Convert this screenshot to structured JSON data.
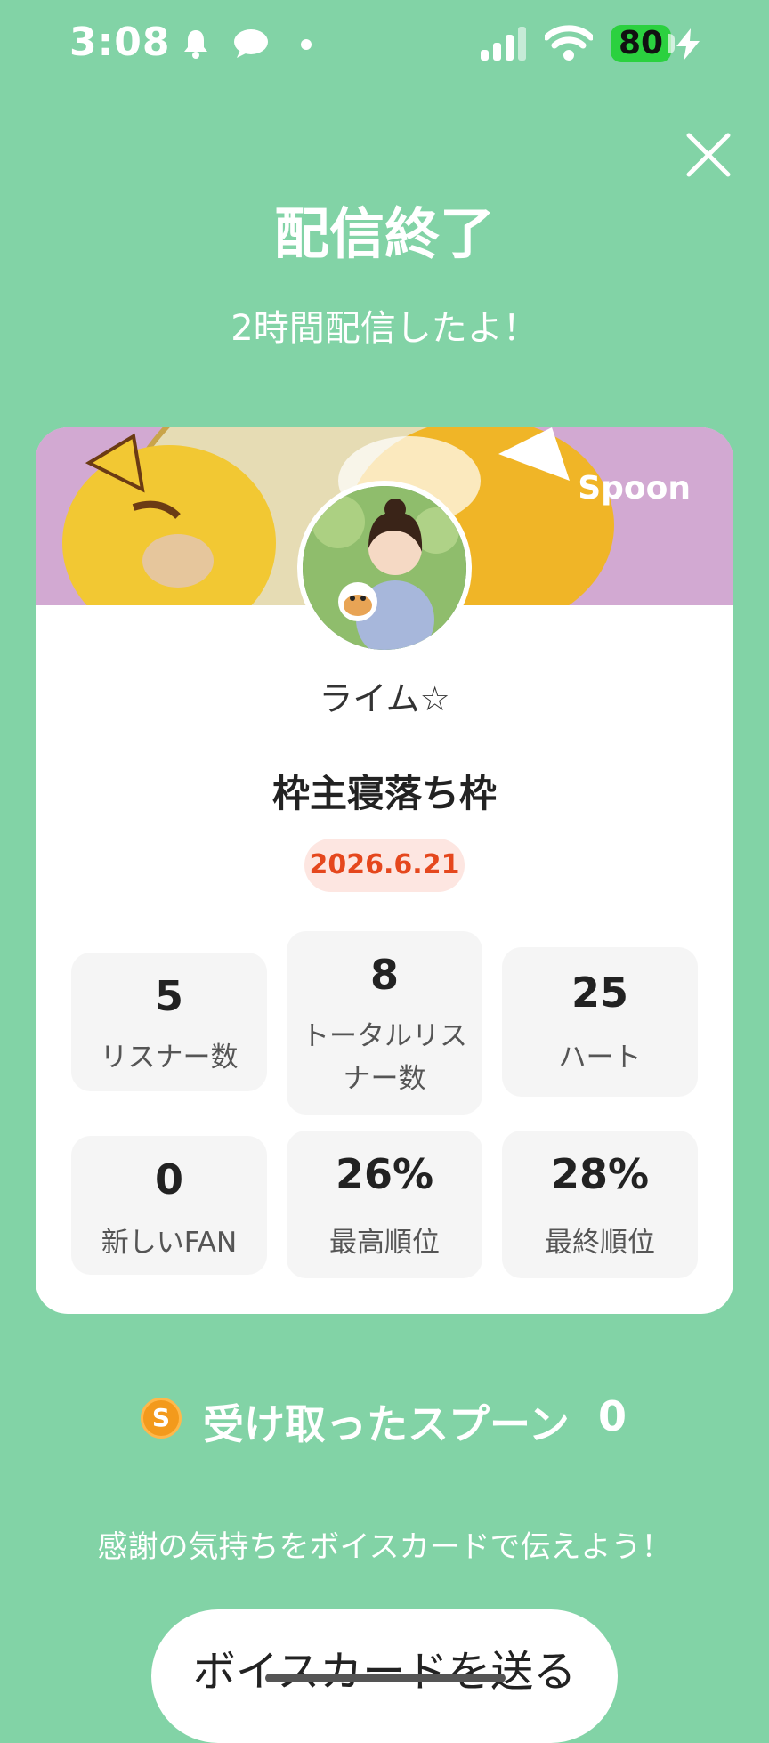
{
  "status_bar": {
    "time": "3:08",
    "battery": "80",
    "icons": [
      "notification-bell-icon",
      "chat-bubble-icon",
      "dot-icon",
      "cellular-signal-icon",
      "wifi-icon",
      "battery-icon",
      "charging-bolt-icon"
    ]
  },
  "header": {
    "title": "配信終了",
    "subtitle": "2時間配信したよ！",
    "close_icon": "close-icon"
  },
  "card": {
    "brand": "Spoon",
    "username": "ライム☆",
    "live_title": "枠主寝落ち枠",
    "date": "2026.6.21",
    "stats": [
      {
        "value": "5",
        "label": "リスナー数"
      },
      {
        "value": "8",
        "label": "トータルリスナー数"
      },
      {
        "value": "25",
        "label": "ハート"
      },
      {
        "value": "0",
        "label": "新しいFAN"
      },
      {
        "value": "26%",
        "label": "最高順位"
      },
      {
        "value": "28%",
        "label": "最終順位"
      }
    ]
  },
  "spoons": {
    "coin_letter": "S",
    "label": "受け取ったスプーン",
    "count": "0"
  },
  "voice_card": {
    "message": "感謝の気持ちをボイスカードで伝えよう！",
    "button_label": "ボイスカードを送る"
  },
  "colors": {
    "background": "#82d3a6",
    "date_text": "#e5471d",
    "date_bg": "#fde6e1",
    "battery": "#2bd13f",
    "coin": "#f39a1c"
  }
}
